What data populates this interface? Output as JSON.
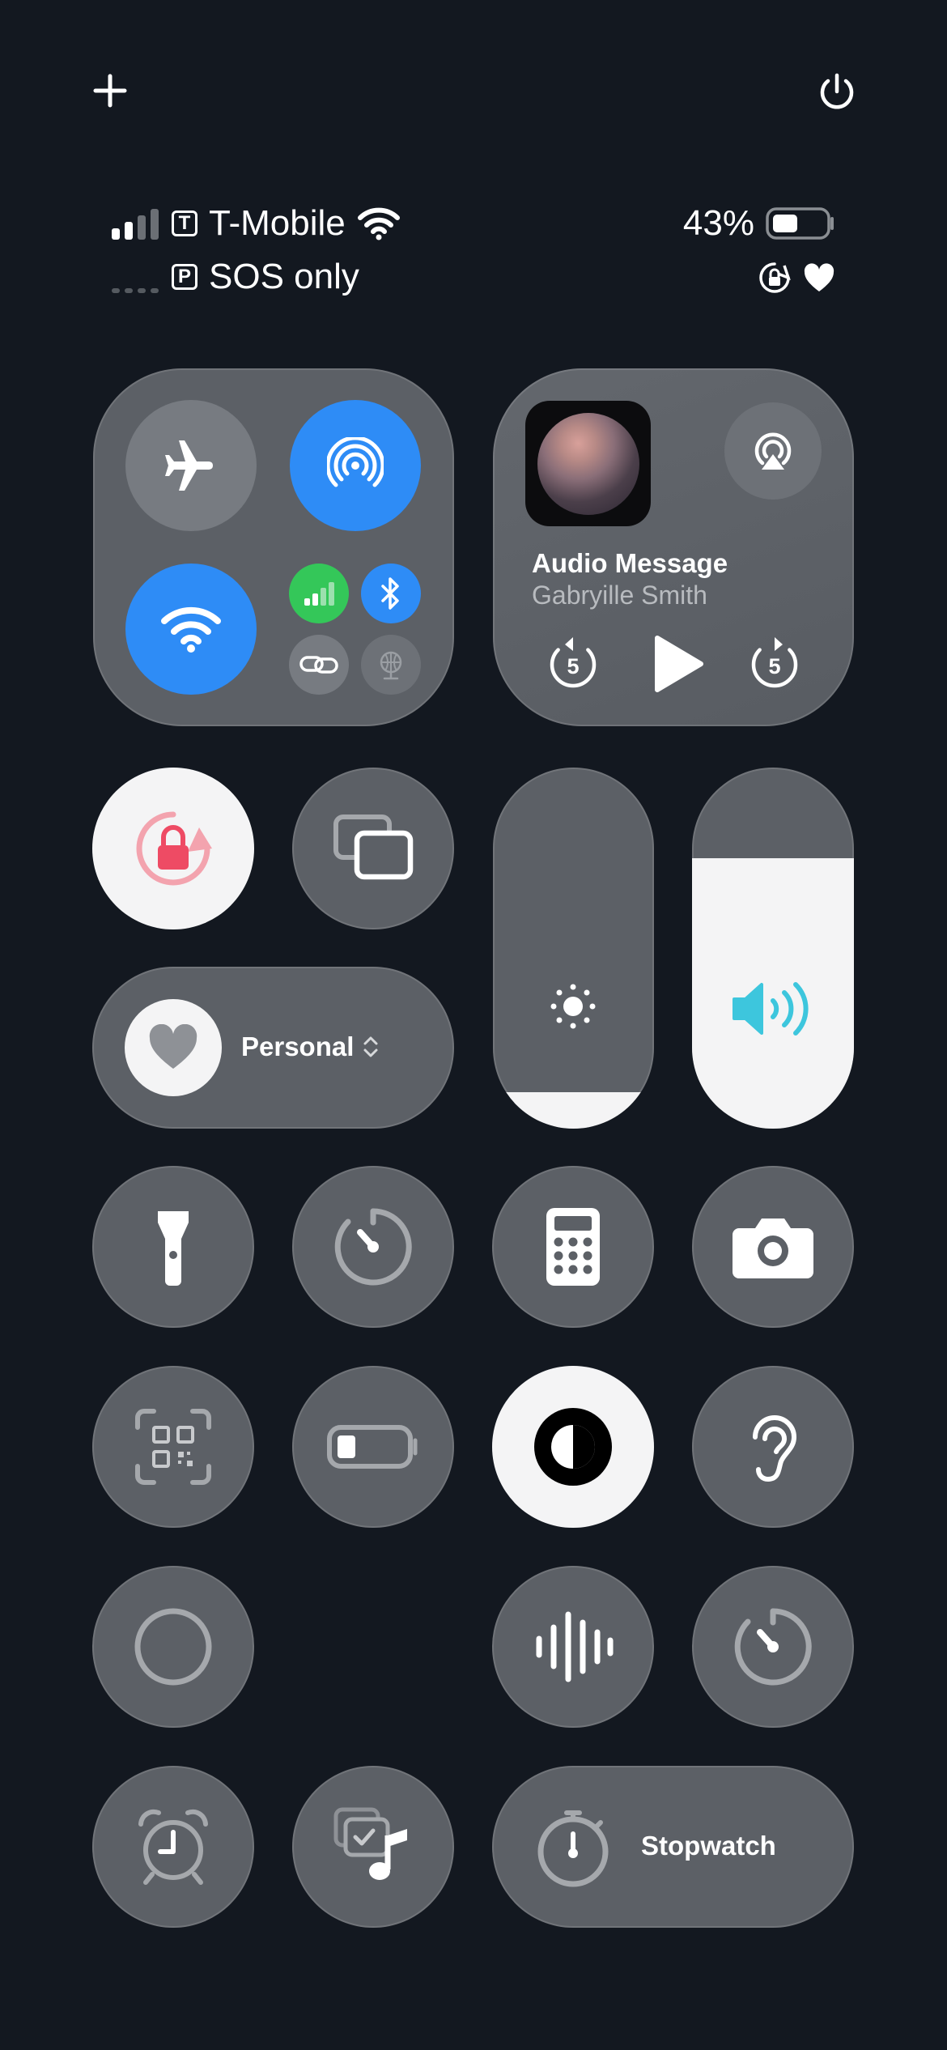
{
  "status": {
    "carrier1_badge": "T",
    "carrier1_name": "T-Mobile",
    "carrier2_badge": "P",
    "carrier2_name": "SOS only",
    "battery_percent": "43%",
    "battery_level": 0.43
  },
  "now_playing": {
    "title": "Audio Message",
    "subtitle": "Gabryille Smith",
    "skip_back_seconds": "5",
    "skip_forward_seconds": "5"
  },
  "focus": {
    "label": "Personal"
  },
  "sliders": {
    "brightness_level": 0.1,
    "volume_level": 0.75
  },
  "stopwatch": {
    "label": "Stopwatch"
  },
  "colors": {
    "accent_blue": "#2e8cf6",
    "cellular_green": "#34c759",
    "rotation_lock_red": "#ee4b64",
    "volume_cyan": "#3dc6dd",
    "tile_gray": "#5c6066"
  },
  "icons": [
    "plus-icon",
    "power-icon",
    "airplane-icon",
    "airdrop-icon",
    "wifi-icon",
    "cellular-icon",
    "bluetooth-icon",
    "link-icon",
    "globe-icon",
    "airplay-icon",
    "rotation-lock-icon",
    "screen-mirroring-icon",
    "heart-icon",
    "brightness-icon",
    "volume-icon",
    "flashlight-icon",
    "timer-icon",
    "calculator-icon",
    "camera-icon",
    "qr-scanner-icon",
    "low-power-icon",
    "dark-mode-icon",
    "hearing-icon",
    "screen-record-icon",
    "sound-recognition-icon",
    "alarm-icon",
    "shazam-icon",
    "stopwatch-icon"
  ]
}
